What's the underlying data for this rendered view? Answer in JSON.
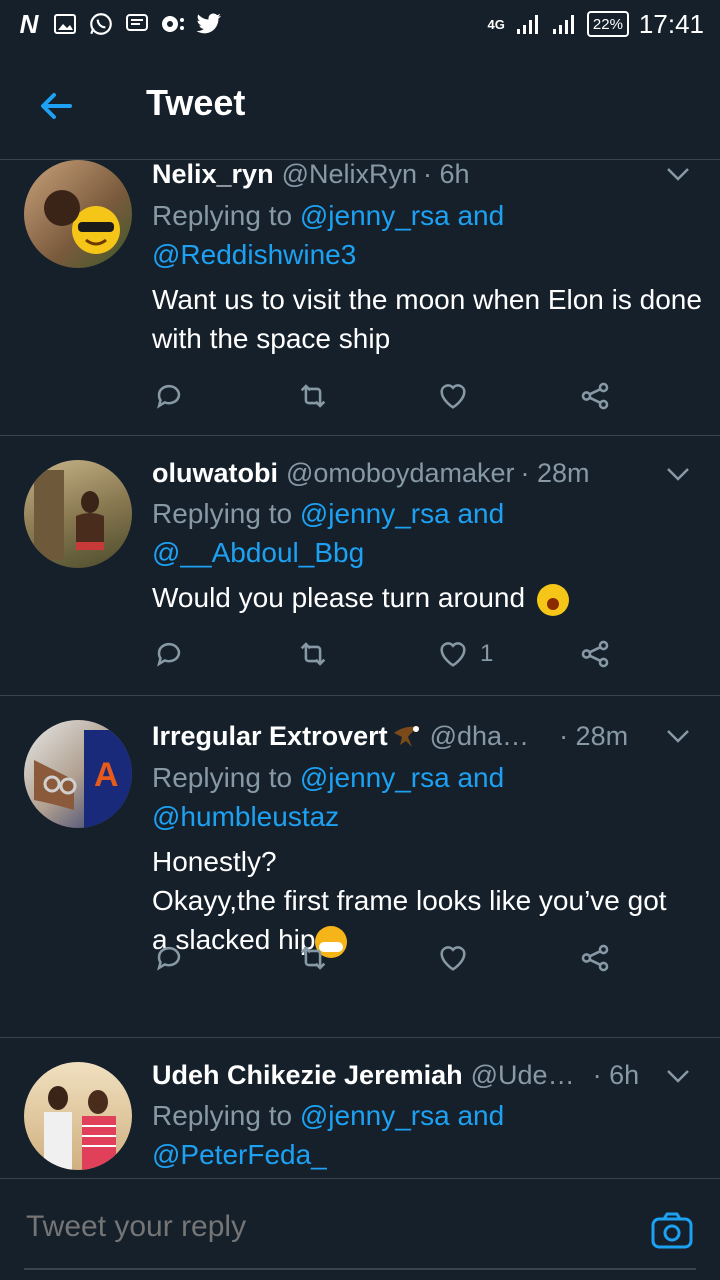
{
  "status": {
    "network": "4G",
    "battery": "22%",
    "time": "17:41"
  },
  "appbar": {
    "title": "Tweet"
  },
  "tweets": [
    {
      "name": "Nelix_ryn",
      "handle": "@NelixRyn",
      "time": "· 6h",
      "replying_prefix": "Replying to",
      "replying_to_1": "@jenny_rsa and",
      "replying_to_2": "@Reddishwine3",
      "text": "Want us to visit the moon when Elon is done with the space ship",
      "likes": ""
    },
    {
      "name": "oluwatobi",
      "handle": "@omoboydamaker",
      "time": "· 28m",
      "replying_prefix": "Replying to",
      "replying_to_1": "@jenny_rsa and",
      "replying_to_2": "@__Abdoul_Bbg",
      "text": "Would you please turn around",
      "likes": "1"
    },
    {
      "name": "Irregular Extrovert",
      "handle": "@dha…",
      "time": "· 28m",
      "replying_prefix": "Replying to",
      "replying_to_1": "@jenny_rsa and",
      "replying_to_2": "@humbleustaz",
      "text_line1": "Honestly?",
      "text_line2": "Okayy,the first frame looks like you’ve got",
      "text_line3": "a slacked hip",
      "likes": ""
    },
    {
      "name": "Udeh Chikezie Jeremiah",
      "handle": "@Ude…",
      "time": "· 6h",
      "replying_prefix": "Replying to",
      "replying_to_1": "@jenny_rsa and",
      "replying_to_2": "@PeterFeda_"
    }
  ],
  "reply": {
    "placeholder": "Tweet your reply"
  },
  "colors": {
    "background": "#15202b",
    "accent": "#1da1f2",
    "muted": "#8899a6",
    "divider": "#38444d"
  }
}
